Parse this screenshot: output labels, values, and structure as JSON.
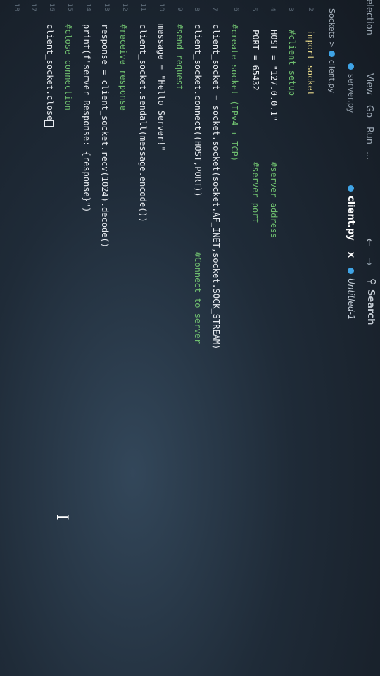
{
  "menubar": {
    "items": [
      "Selection",
      "View",
      "Go",
      "Run",
      "..."
    ],
    "search_label": "Search"
  },
  "tabs": [
    {
      "label": "server.py",
      "active": false
    },
    {
      "label": "client.py",
      "active": true,
      "close": "x"
    },
    {
      "label": "Untitled-1",
      "active": false
    }
  ],
  "breadcrumb": {
    "root": "Sockets",
    "separator": ">",
    "file": "client.py"
  },
  "code": {
    "line1": "import socket",
    "line2_comment": "#client setup",
    "line3": "HOST = \"127.0.0.1\"",
    "line3_comment": "#server address",
    "line4": "PORT = 65432",
    "line4_comment": "#server port",
    "line5_comment": "#create socket (IPv4 + TCP)",
    "line6": "client_socket = socket.socket(socket.AF_INET,socket.SOCK_STREAM)",
    "line7": "client_socket.connect((HOST,PORT))",
    "line7_comment": "#Connect to server",
    "line8_comment": "#send request",
    "line9": "message = \"Hello Server!\"",
    "line10": "client_socket.sendall(message.encode())",
    "line11_comment": "#receive response",
    "line12": "response = client_socket.recv(1024).decode()",
    "line13": "print(f\"server Response: {response}\")",
    "line14_comment": "#close connection",
    "line15": "client_socket.close"
  },
  "gutter": [
    "2",
    "3",
    "4",
    "5",
    "6",
    "7",
    "8",
    "9",
    "10",
    "11",
    "12",
    "13",
    "14",
    "15",
    "16",
    "17",
    "18"
  ],
  "colors": {
    "keyword": "#e8d98a",
    "comment": "#6fbf6f",
    "python_icon": "#3fa4e6"
  }
}
